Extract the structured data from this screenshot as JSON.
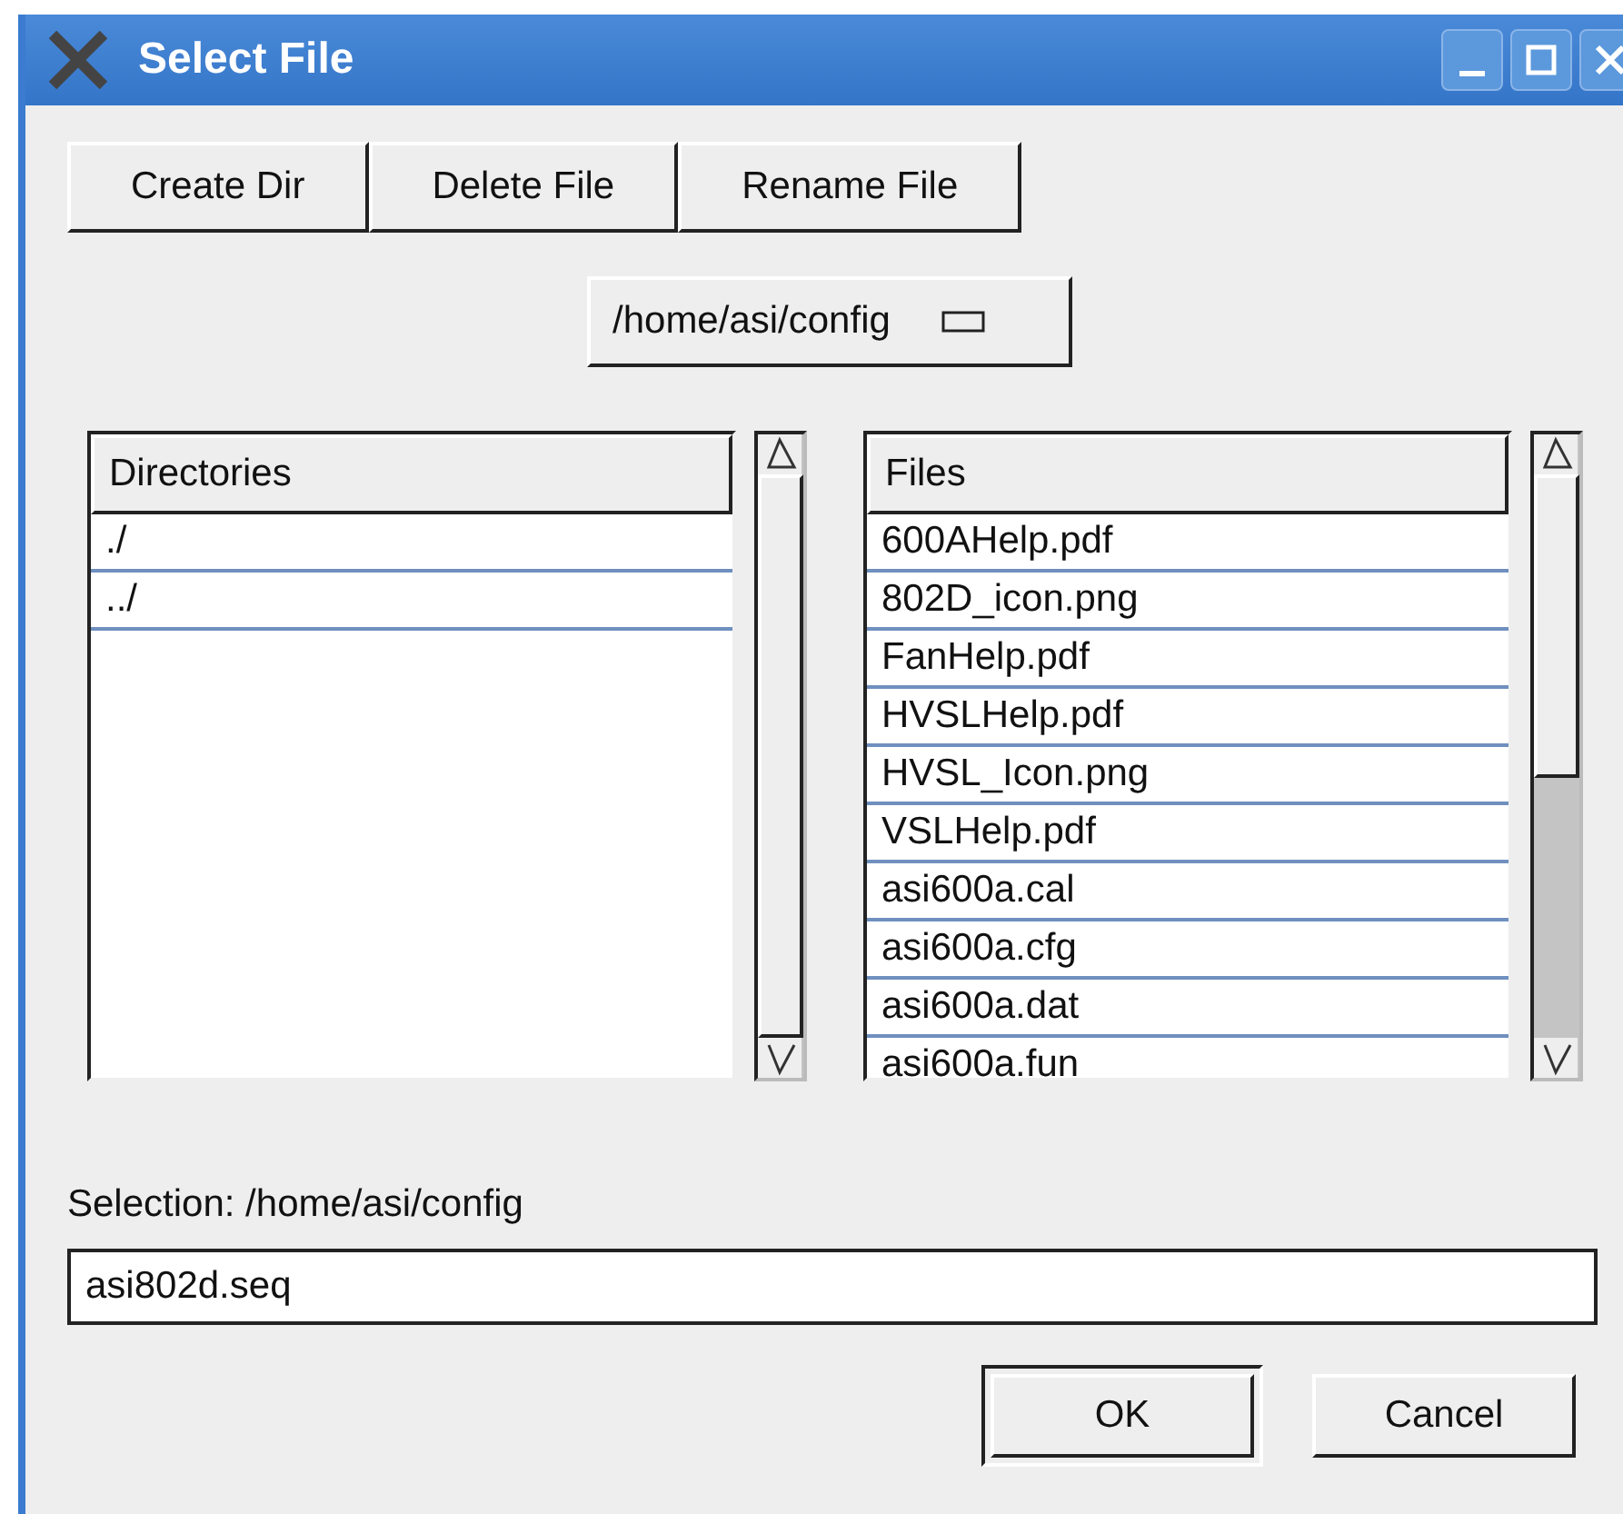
{
  "window": {
    "title": "Select File"
  },
  "actions": [
    {
      "label": "Create Dir"
    },
    {
      "label": "Delete File"
    },
    {
      "label": "Rename File"
    }
  ],
  "path_menu": {
    "value": "/home/asi/config"
  },
  "directories": {
    "heading": "Directories",
    "items": [
      "./",
      "../"
    ]
  },
  "files": {
    "heading": "Files",
    "items": [
      "600AHelp.pdf",
      "802D_icon.png",
      "FanHelp.pdf",
      "HVSLHelp.pdf",
      "HVSL_Icon.png",
      "VSLHelp.pdf",
      "asi600a.cal",
      "asi600a.cfg",
      "asi600a.dat",
      "asi600a.fun"
    ]
  },
  "selection": {
    "label": "Selection: /home/asi/config",
    "value": "asi802d.seq"
  },
  "buttons": [
    {
      "label": "OK",
      "default": true
    },
    {
      "label": "Cancel",
      "default": false
    }
  ]
}
